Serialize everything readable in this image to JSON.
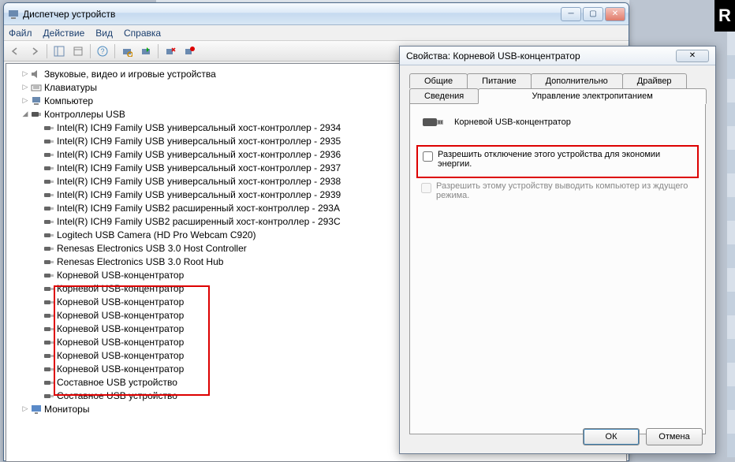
{
  "device_manager": {
    "title": "Диспетчер устройств",
    "menu": {
      "file": "Файл",
      "action": "Действие",
      "view": "Вид",
      "help": "Справка"
    },
    "tree": {
      "sound": "Звуковые, видео и игровые устройства",
      "keyboards": "Клавиатуры",
      "computer": "Компьютер",
      "usb_controllers": "Контроллеры USB",
      "usb_items": [
        "Intel(R) ICH9 Family USB универсальный хост-контроллер - 2934",
        "Intel(R) ICH9 Family USB универсальный хост-контроллер - 2935",
        "Intel(R) ICH9 Family USB универсальный хост-контроллер - 2936",
        "Intel(R) ICH9 Family USB универсальный хост-контроллер - 2937",
        "Intel(R) ICH9 Family USB универсальный хост-контроллер - 2938",
        "Intel(R) ICH9 Family USB универсальный хост-контроллер - 2939",
        "Intel(R) ICH9 Family USB2 расширенный хост-контроллер - 293A",
        "Intel(R) ICH9 Family USB2 расширенный хост-контроллер - 293C",
        "Logitech USB Camera (HD Pro Webcam C920)",
        "Renesas Electronics USB 3.0 Host Controller",
        "Renesas Electronics USB 3.0 Root Hub",
        "Корневой USB-концентратор",
        "Корневой USB-концентратор",
        "Корневой USB-концентратор",
        "Корневой USB-концентратор",
        "Корневой USB-концентратор",
        "Корневой USB-концентратор",
        "Корневой USB-концентратор",
        "Корневой USB-концентратор",
        "Составное USB устройство",
        "Составное USB устройство"
      ],
      "monitors": "Мониторы"
    }
  },
  "properties": {
    "title": "Свойства: Корневой USB-концентратор",
    "tabs": {
      "general": "Общие",
      "power": "Питание",
      "advanced": "Дополнительно",
      "driver": "Драйвер",
      "details": "Сведения",
      "power_mgmt": "Управление электропитанием"
    },
    "device_name": "Корневой USB-концентратор",
    "chk_allow_off": "Разрешить отключение этого устройства для экономии энергии.",
    "chk_allow_wake": "Разрешить этому устройству выводить компьютер из ждущего режима.",
    "ok": "ОК",
    "cancel": "Отмена"
  }
}
